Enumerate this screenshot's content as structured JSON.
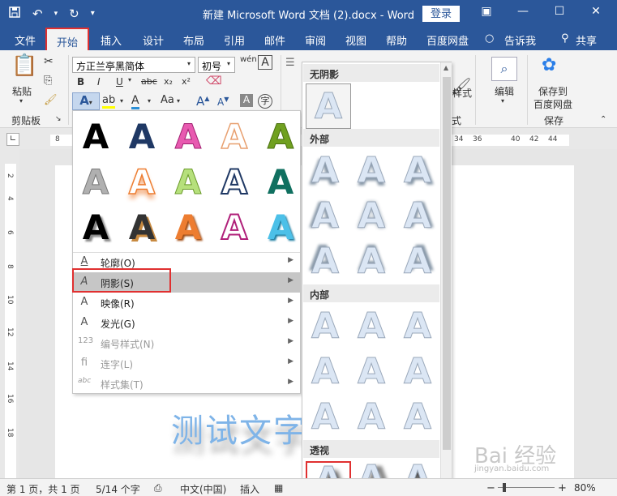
{
  "app": {
    "title": "新建 Microsoft Word 文档 (2).docx  -  Word",
    "login_label": "登录"
  },
  "qat": {
    "save_icon": "save-icon",
    "undo_icon": "undo-icon",
    "redo_icon": "redo-icon",
    "customize_icon": "customize-qat-icon"
  },
  "tabs": [
    "文件",
    "开始",
    "插入",
    "设计",
    "布局",
    "引用",
    "邮件",
    "审阅",
    "视图",
    "帮助",
    "百度网盘"
  ],
  "tell_me": "告诉我",
  "share": "共享",
  "ribbon": {
    "clipboard": {
      "paste_label": "粘贴",
      "group_label": "剪贴板"
    },
    "font": {
      "font_name": "方正兰亭黑简体",
      "font_size": "初号"
    },
    "editing": {
      "label": "编辑"
    },
    "styles": {
      "label": "样式",
      "group_label": "式"
    },
    "save": {
      "label1": "保存到",
      "label2": "百度网盘",
      "group_label": "保存"
    }
  },
  "ruler": {
    "h_numbers": [
      "8",
      "34",
      "36",
      "40",
      "42",
      "44"
    ],
    "v_numbers": [
      "2",
      "4",
      "6",
      "8",
      "10",
      "12",
      "14",
      "16",
      "18"
    ]
  },
  "document": {
    "text": "测试文字三"
  },
  "text_effects_menu": {
    "items": [
      {
        "label": "轮廓(O)",
        "icon": "outline-icon",
        "disabled": false
      },
      {
        "label": "阴影(S)",
        "icon": "shadow-icon",
        "disabled": false
      },
      {
        "label": "映像(R)",
        "icon": "reflection-icon",
        "disabled": false
      },
      {
        "label": "发光(G)",
        "icon": "glow-icon",
        "disabled": false
      },
      {
        "label": "编号样式(N)",
        "icon": "number-style-icon",
        "disabled": true
      },
      {
        "label": "连字(L)",
        "icon": "ligature-icon",
        "disabled": true
      },
      {
        "label": "样式集(T)",
        "icon": "style-set-icon",
        "disabled": true
      }
    ]
  },
  "shadow_menu": {
    "sections": [
      "无阴影",
      "外部",
      "内部",
      "透视"
    ]
  },
  "statusbar": {
    "page": "第 1 页，共 1 页",
    "words": "5/14 个字",
    "lang": "中文(中国)",
    "mode": "插入",
    "zoom": "80%"
  },
  "watermark": {
    "text": "Bai 经验",
    "url": "jingyan.baidu.com"
  },
  "colors": {
    "accent": "#2b579a",
    "highlight_box": "#e03030"
  }
}
